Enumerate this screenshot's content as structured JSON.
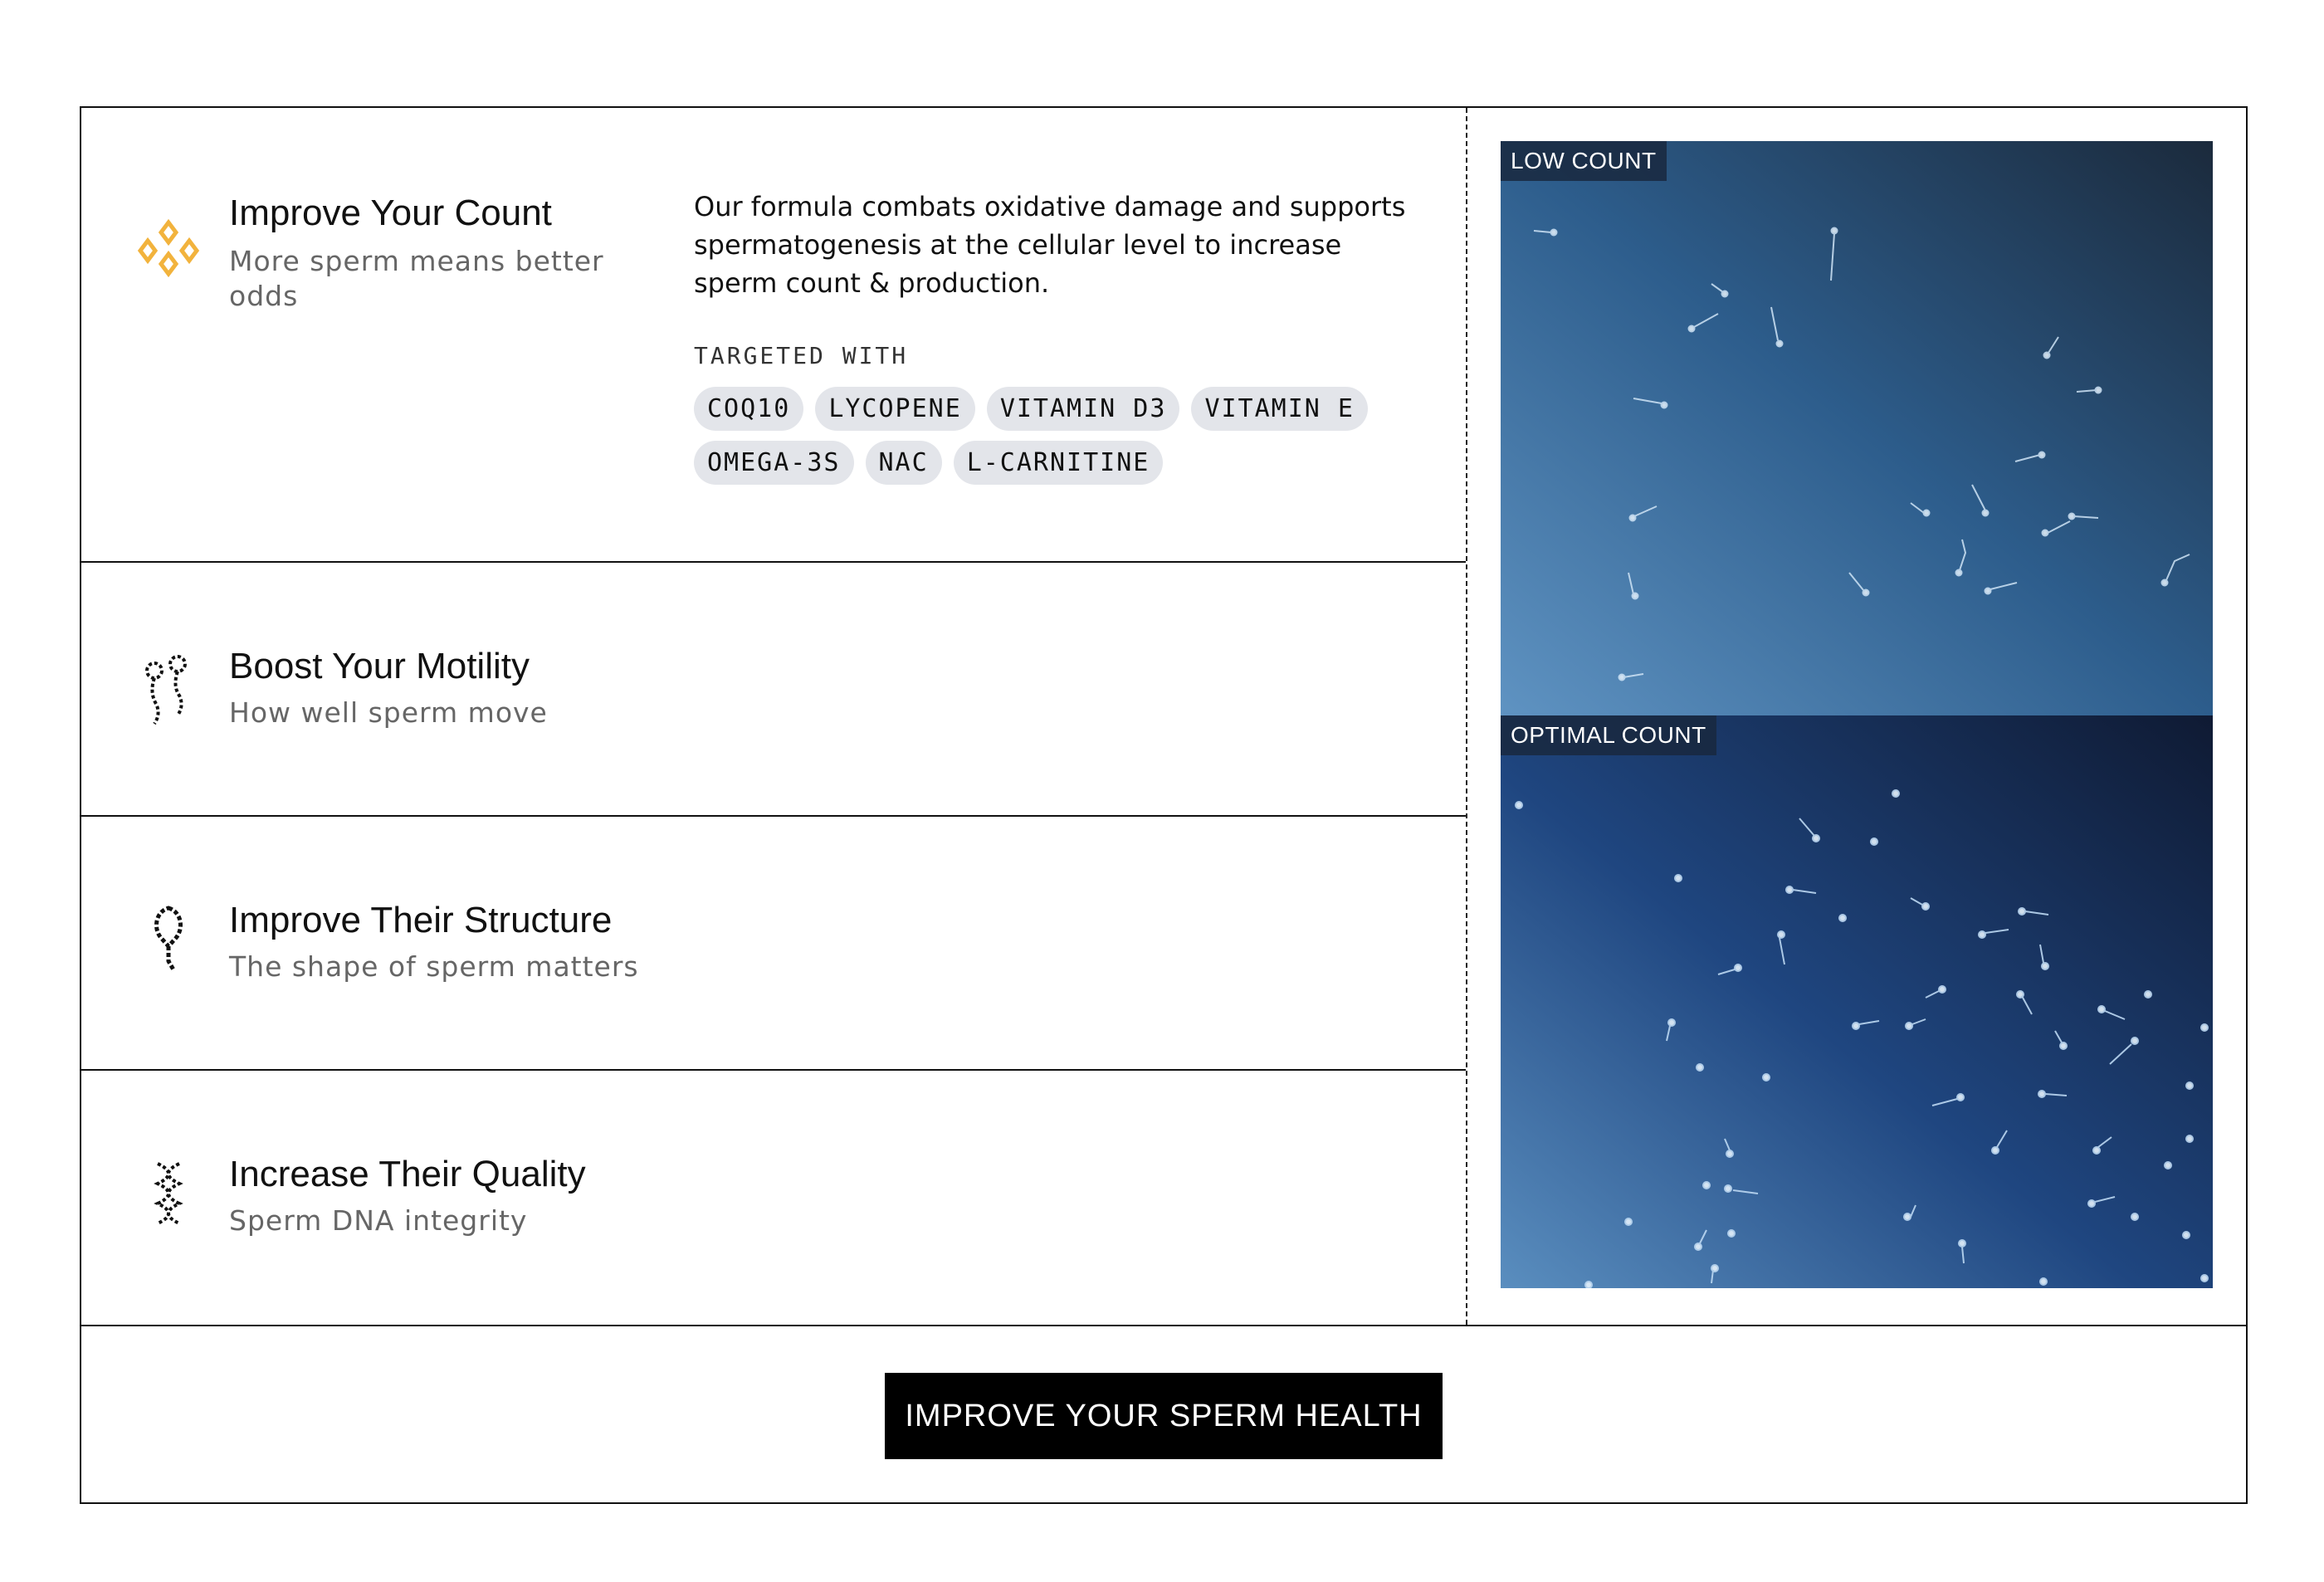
{
  "features": [
    {
      "title": "Improve Your Count",
      "subtitle": "More sperm means better odds",
      "icon": "diamond-cluster-icon",
      "expanded": true,
      "description": "Our formula combats oxidative damage and supports spermatogenesis at the cellular level to increase sperm count & production.",
      "targeted_label": "TARGETED WITH",
      "ingredients": [
        "COQ10",
        "LYCOPENE",
        "VITAMIN D3",
        "VITAMIN E",
        "OMEGA-3S",
        "NAC",
        "L-CARNITINE"
      ]
    },
    {
      "title": "Boost Your Motility",
      "subtitle": "How well sperm move",
      "icon": "swimming-sperm-icon"
    },
    {
      "title": "Improve Their Structure",
      "subtitle": "The shape of sperm matters",
      "icon": "sperm-shape-icon"
    },
    {
      "title": "Increase Their Quality",
      "subtitle": "Sperm DNA integrity",
      "icon": "dna-helix-icon"
    }
  ],
  "comparison": {
    "low_label": "LOW COUNT",
    "optimal_label": "OPTIMAL COUNT"
  },
  "cta": {
    "label": "IMPROVE YOUR SPERM HEALTH"
  },
  "colors": {
    "accent": "#f2b33d",
    "chip_bg": "#e3e5ea",
    "cta_bg": "#000000"
  }
}
